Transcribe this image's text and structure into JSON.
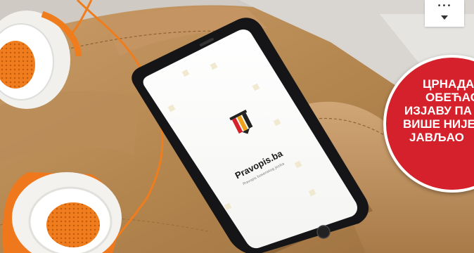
{
  "app": {
    "name": "Pravopis.ba",
    "tagline": "Pravopis bosanskog jezika"
  },
  "badge": {
    "lines": [
      "ЦРНАДАК",
      "ОБЕЋАО",
      "ИЗЈАВУ ПА",
      "ВИШЕ НИЈЕ",
      "ЈАВЉАО"
    ]
  },
  "colors": {
    "badge": "#d5212b",
    "leather": "#b58a5a",
    "cable": "#f07d1d",
    "phone": "#151517"
  },
  "icons": [
    "menu-expand-icon",
    "column-logo-icon"
  ]
}
